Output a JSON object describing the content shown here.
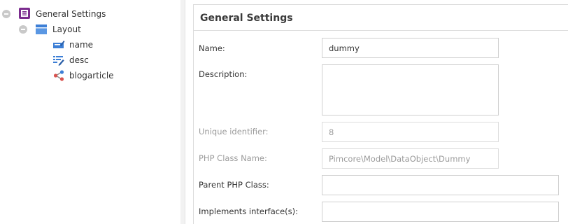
{
  "tree": {
    "root": {
      "label": "General Settings",
      "icon": "class-definition-icon",
      "color": "#7b2c8e"
    },
    "layout": {
      "label": "Layout",
      "icon": "panel-layout-icon",
      "color": "#3d7fd6"
    },
    "fields": [
      {
        "label": "name",
        "icon": "input-field-icon"
      },
      {
        "label": "desc",
        "icon": "textarea-field-icon"
      },
      {
        "label": "blogarticle",
        "icon": "relation-field-icon"
      }
    ]
  },
  "form": {
    "title": "General Settings",
    "name": {
      "label": "Name:",
      "value": "dummy"
    },
    "description": {
      "label": "Description:",
      "value": ""
    },
    "unique_identifier": {
      "label": "Unique identifier:",
      "value": "8"
    },
    "php_class_name": {
      "label": "PHP Class Name:",
      "value": "Pimcore\\Model\\DataObject\\Dummy"
    },
    "parent_php_class": {
      "label": "Parent PHP Class:",
      "value": ""
    },
    "implements_interfaces": {
      "label": "Implements interface(s):",
      "value": ""
    }
  },
  "colors": {
    "accent_purple": "#7b2c8e",
    "accent_blue": "#3d7fd6",
    "relation_red": "#d9534f"
  }
}
